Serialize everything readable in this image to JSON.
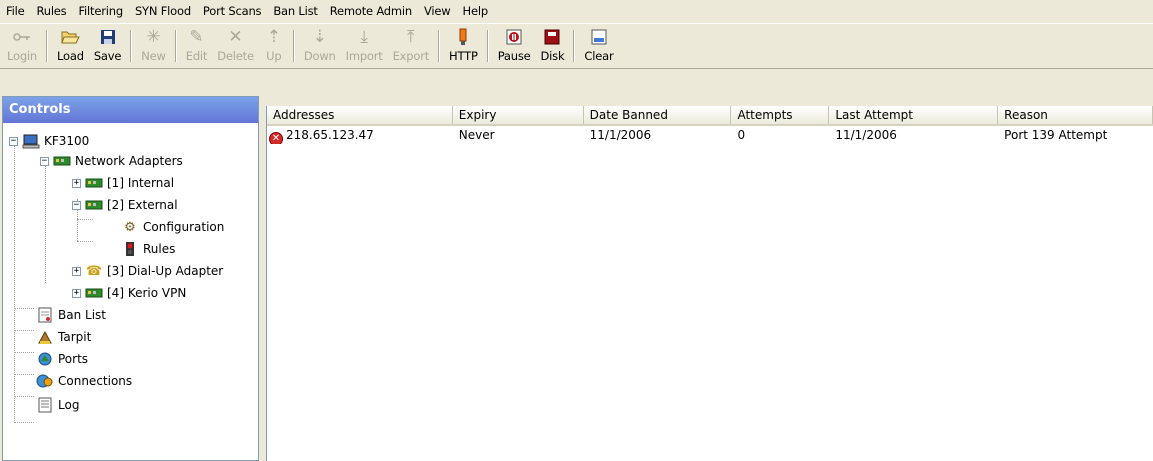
{
  "menubar": {
    "items": [
      "File",
      "Rules",
      "Filtering",
      "SYN Flood",
      "Port Scans",
      "Ban List",
      "Remote Admin",
      "View",
      "Help"
    ]
  },
  "toolbar": {
    "login": "Login",
    "load": "Load",
    "save": "Save",
    "new": "New",
    "edit": "Edit",
    "delete": "Delete",
    "up": "Up",
    "down": "Down",
    "import": "Import",
    "export": "Export",
    "http": "HTTP",
    "pause": "Pause",
    "disk": "Disk",
    "clear": "Clear"
  },
  "controls": {
    "title": "Controls",
    "tree": {
      "root": "KF3100",
      "network_adapters": "Network Adapters",
      "internal": "[1] Internal",
      "external": "[2] External",
      "configuration": "Configuration",
      "rules": "Rules",
      "dialup": "[3] Dial-Up Adapter",
      "kerio": "[4] Kerio VPN",
      "ban_list": "Ban List",
      "tarpit": "Tarpit",
      "ports": "Ports",
      "connections": "Connections",
      "log": "Log"
    }
  },
  "banlist": {
    "columns": [
      "Addresses",
      "Expiry",
      "Date Banned",
      "Attempts",
      "Last Attempt",
      "Reason"
    ],
    "rows": [
      {
        "address": "218.65.123.47",
        "expiry": "Never",
        "date_banned": "11/1/2006",
        "attempts": "0",
        "last_attempt": "11/1/2006",
        "reason": "Port 139 Attempt"
      }
    ]
  }
}
